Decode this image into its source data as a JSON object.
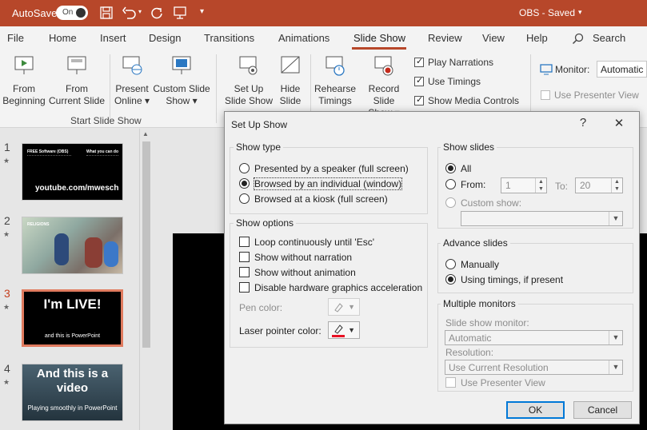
{
  "titlebar": {
    "autosave_label": "AutoSave",
    "autosave_state": "On",
    "document_title": "OBS - Saved"
  },
  "menu": {
    "items": [
      "File",
      "Home",
      "Insert",
      "Design",
      "Transitions",
      "Animations",
      "Slide Show",
      "Review",
      "View",
      "Help"
    ],
    "active": "Slide Show",
    "search_label": "Search"
  },
  "ribbon": {
    "start_group_label": "Start Slide Show",
    "from_beginning": [
      "From",
      "Beginning"
    ],
    "from_current": [
      "From",
      "Current Slide"
    ],
    "present_online": [
      "Present",
      "Online ▾"
    ],
    "custom_show": [
      "Custom Slide",
      "Show ▾"
    ],
    "setup_show": [
      "Set Up",
      "Slide Show"
    ],
    "hide_slide": [
      "Hide",
      "Slide"
    ],
    "rehearse": [
      "Rehearse",
      "Timings"
    ],
    "record": [
      "Record Slide",
      "Show ▾"
    ],
    "checks": [
      {
        "label": "Play Narrations",
        "checked": true
      },
      {
        "label": "Use Timings",
        "checked": true
      },
      {
        "label": "Show Media Controls",
        "checked": true
      }
    ],
    "monitor_label": "Monitor:",
    "monitor_value": "Automatic",
    "presenter_view": "Use Presenter View"
  },
  "slides": [
    {
      "num": "1",
      "title": "FREE Software (OBS)",
      "right": "What you can do",
      "line": "youtube.com/mwesch"
    },
    {
      "num": "2",
      "title": "RELIGIONS"
    },
    {
      "num": "3",
      "title": "I'm LIVE!",
      "sub": "and this is PowerPoint"
    },
    {
      "num": "4",
      "title": "And this is a video",
      "sub": "Playing smoothly in PowerPoint"
    }
  ],
  "dialog": {
    "title": "Set Up Show",
    "help": "?",
    "close": "✕",
    "show_type": {
      "label": "Show type",
      "options": [
        "Presented by a speaker (full screen)",
        "Browsed by an individual (window)",
        "Browsed at a kiosk (full screen)"
      ]
    },
    "show_options": {
      "label": "Show options",
      "options": [
        "Loop continuously until 'Esc'",
        "Show without narration",
        "Show without animation",
        "Disable hardware graphics acceleration"
      ],
      "pen_color": "Pen color:",
      "laser_color": "Laser pointer color:"
    },
    "show_slides": {
      "label": "Show slides",
      "all": "All",
      "from": "From:",
      "from_value": "1",
      "to": "To:",
      "to_value": "20",
      "custom": "Custom show:"
    },
    "advance": {
      "label": "Advance slides",
      "manually": "Manually",
      "timings": "Using timings, if present"
    },
    "monitors": {
      "label": "Multiple monitors",
      "slide_monitor": "Slide show monitor:",
      "slide_monitor_value": "Automatic",
      "resolution": "Resolution:",
      "resolution_value": "Use Current Resolution",
      "presenter": "Use Presenter View"
    },
    "ok": "OK",
    "cancel": "Cancel"
  },
  "colors": {
    "accent": "#b7472a",
    "laser": "#e81123",
    "default_button": "#0078d7"
  }
}
